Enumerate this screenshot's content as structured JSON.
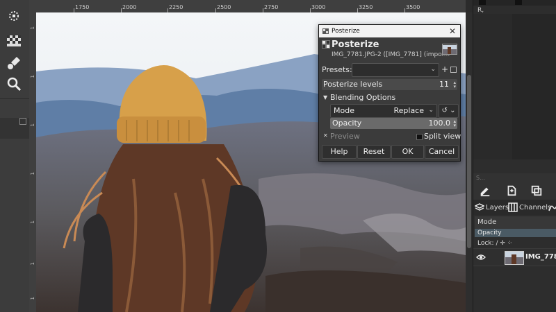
{
  "ruler": {
    "top_labels": [
      "1750",
      "2000",
      "2250",
      "2500",
      "2750",
      "3000",
      "3250",
      "3500"
    ],
    "left_labels": [
      "1",
      "1",
      "1",
      "1",
      "1",
      "1",
      "1"
    ]
  },
  "dialog": {
    "window_title": "Posterize",
    "heading": "Posterize",
    "subtitle": "IMG_7781.JPG-2 ([IMG_7781] (impor...",
    "presets_label": "Presets:",
    "presets_value": "",
    "presets_add": "+",
    "levels_label": "Posterize levels",
    "levels_value": "11",
    "blending_label": "Blending Options",
    "mode_label": "Mode",
    "mode_value": "Replace",
    "mode_extra": "↺",
    "opacity_label": "Opacity",
    "opacity_value": "100.0",
    "opacity_fraction": 1.0,
    "preview_label": "Preview",
    "preview_checked": true,
    "split_label": "Split view",
    "split_checked": false,
    "buttons": {
      "help": "Help",
      "reset": "Reset",
      "ok": "OK",
      "cancel": "Cancel"
    }
  },
  "dock": {
    "r_label": "R,",
    "faint_label": "S...",
    "tabs": {
      "layers": "Layers",
      "channels": "Channels"
    },
    "mode_label": "Mode",
    "opacity_label": "Opacity",
    "lock_label": "Lock:",
    "lock_icons": "∕ ✛ ⁘",
    "layer_name": "IMG_778"
  },
  "colors": {
    "sky": "#e9eef2",
    "beanie": "#d7a04a",
    "hair": "#6a3f2a",
    "mountains": "#5f7ea6",
    "jacket": "#2b2a2c"
  },
  "icons": [
    "fuzzy-select-icon",
    "gradient-icon",
    "paint-brush-icon",
    "magnify-icon",
    "close-icon",
    "posterize-icon",
    "eye-icon"
  ]
}
